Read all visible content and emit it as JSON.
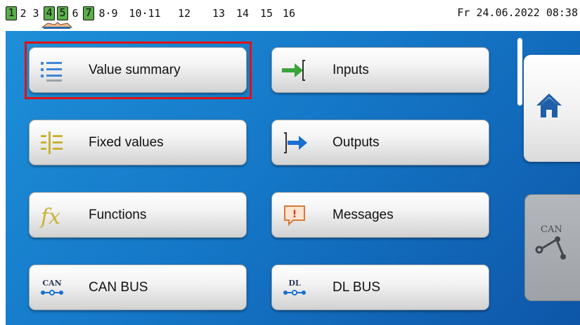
{
  "status_bar": {
    "channels": [
      {
        "label": "1",
        "active": true
      },
      {
        "label": "2",
        "active": false
      },
      {
        "label": "3",
        "active": false
      },
      {
        "label": "4",
        "active": true
      },
      {
        "label": "5",
        "active": true
      },
      {
        "label": "6",
        "active": false
      },
      {
        "label": "7",
        "active": true
      },
      {
        "label": "8·9",
        "active": false
      },
      {
        "label": "10·11",
        "active": false
      },
      {
        "label": "12",
        "active": false
      },
      {
        "label": "13",
        "active": false
      },
      {
        "label": "14",
        "active": false
      },
      {
        "label": "15",
        "active": false
      },
      {
        "label": "16",
        "active": false
      }
    ],
    "datetime": "Fr 24.06.2022 08:38"
  },
  "menu": {
    "value_summary": "Value summary",
    "inputs": "Inputs",
    "fixed_values": "Fixed values",
    "outputs": "Outputs",
    "functions": "Functions",
    "messages": "Messages",
    "can_bus": "CAN BUS",
    "dl_bus": "DL BUS"
  },
  "icons": {
    "value_summary": "list-icon",
    "inputs": "input-arrow-icon",
    "fixed_values": "fixed-values-icon",
    "outputs": "output-arrow-icon",
    "functions": "fx-icon",
    "messages": "message-icon",
    "can_bus": "can-bus-icon",
    "dl_bus": "dl-bus-icon",
    "home": "home-icon",
    "can_side": "can-network-icon"
  },
  "icon_text": {
    "can": "CAN",
    "dl": "DL",
    "fx": "fx",
    "exclamation": "!"
  },
  "side": {
    "can_label": "CAN"
  },
  "colors": {
    "panel_blue": "#1578c8",
    "active_channel": "#5aae4a",
    "highlight": "#e01212",
    "arrow_green": "#3aa33a",
    "arrow_blue": "#1a6fd0"
  }
}
